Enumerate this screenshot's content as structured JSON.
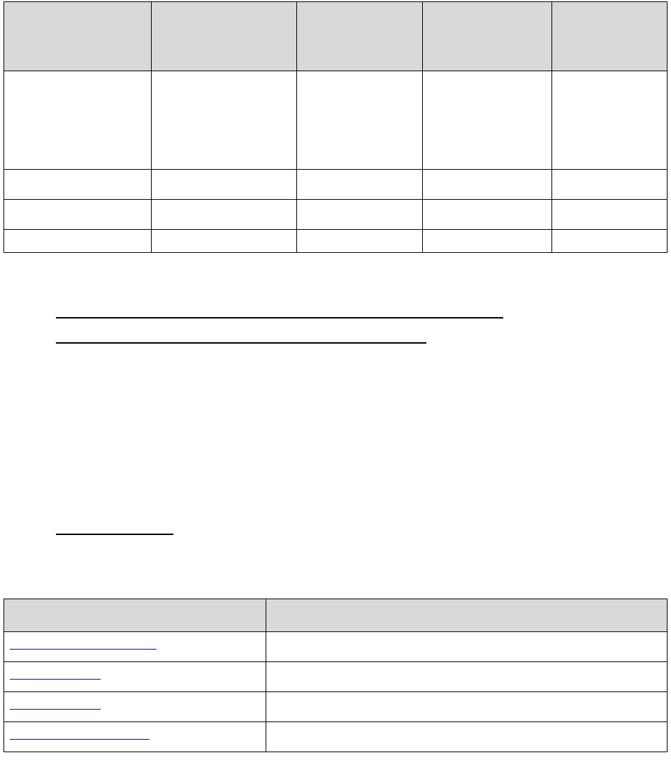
{
  "table1": {
    "headers": [
      "",
      "",
      "",
      "",
      ""
    ],
    "rows": [
      [
        "",
        "",
        "",
        "",
        ""
      ],
      [
        "",
        "",
        "",
        "",
        ""
      ],
      [
        "",
        "",
        "",
        "",
        ""
      ],
      [
        "",
        "",
        "",
        "",
        ""
      ]
    ]
  },
  "table2": {
    "headers": [
      "",
      ""
    ],
    "rows": [
      [
        "",
        ""
      ],
      [
        "",
        ""
      ],
      [
        "",
        ""
      ],
      [
        "",
        ""
      ]
    ],
    "links": [
      "",
      "",
      "",
      ""
    ]
  }
}
